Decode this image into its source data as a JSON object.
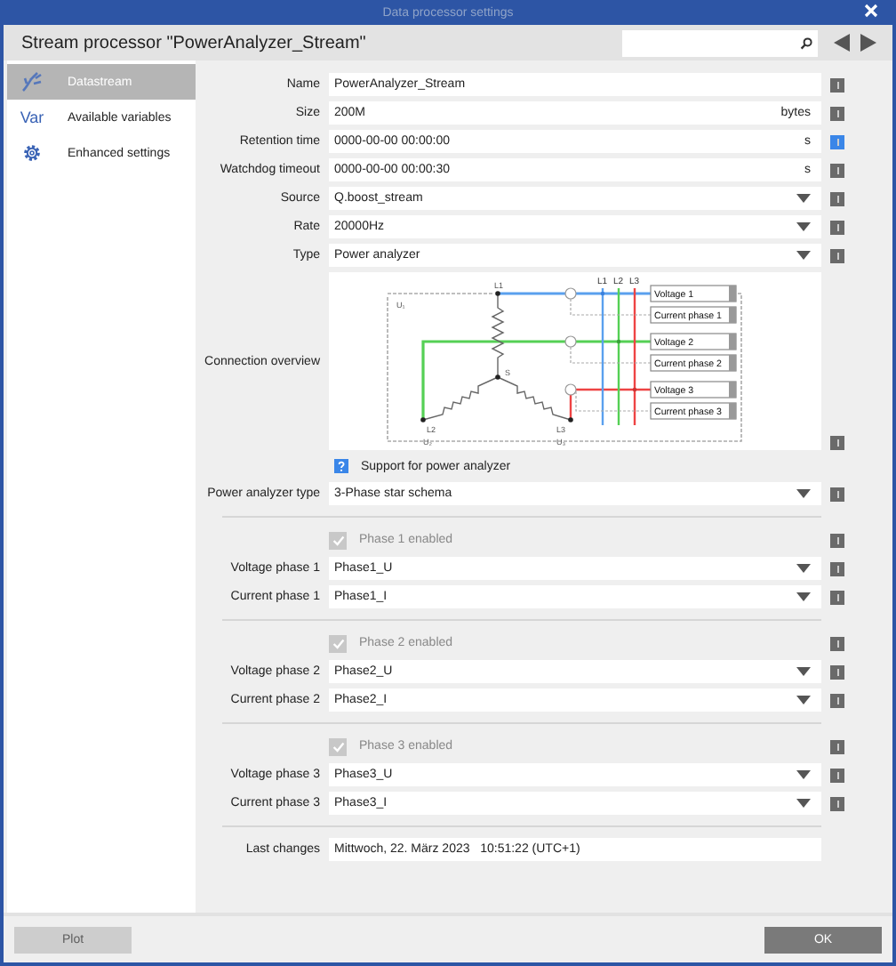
{
  "window": {
    "title": "Data processor settings"
  },
  "header": {
    "title": "Stream processor \"PowerAnalyzer_Stream\""
  },
  "sidebar": {
    "items": [
      {
        "kind": "wave",
        "label": "Datastream",
        "selected": true
      },
      {
        "kind": "var",
        "icon_text": "Var",
        "label": "Available variables",
        "selected": false
      },
      {
        "kind": "gear",
        "label": "Enhanced settings",
        "selected": false
      }
    ]
  },
  "form": {
    "rows": [
      {
        "kind": "text",
        "label": "Name",
        "value": "PowerAnalyzer_Stream",
        "info_active": false
      },
      {
        "kind": "text",
        "label": "Size",
        "value": "200M",
        "unit": "bytes",
        "info_active": false
      },
      {
        "kind": "text",
        "label": "Retention time",
        "value": "0000-00-00 00:00:00",
        "unit": "s",
        "info_active": true
      },
      {
        "kind": "text",
        "label": "Watchdog timeout",
        "value": "0000-00-00 00:00:30",
        "unit": "s",
        "info_active": false
      },
      {
        "kind": "select",
        "label": "Source",
        "value": "Q.boost_stream",
        "info_active": false
      },
      {
        "kind": "select",
        "label": "Rate",
        "value": "20000Hz",
        "info_active": false
      },
      {
        "kind": "select",
        "label": "Type",
        "value": "Power analyzer",
        "info_active": false
      },
      {
        "kind": "diagram",
        "label": "Connection overview",
        "info_active": false,
        "line_labels": [
          "L1",
          "L2",
          "L3"
        ],
        "node_labels": [
          "L1",
          "U₁",
          "S",
          "L2",
          "U₂",
          "L3",
          "U₃"
        ],
        "terminals": [
          "Voltage 1",
          "Current phase 1",
          "Voltage 2",
          "Current phase 2",
          "Voltage 3",
          "Current phase 3"
        ]
      },
      {
        "kind": "help",
        "text": "Support for power analyzer"
      },
      {
        "kind": "select",
        "label": "Power analyzer type",
        "value": "3-Phase star schema",
        "info_active": false
      },
      {
        "kind": "divider"
      },
      {
        "kind": "check",
        "label": "Phase 1 enabled",
        "checked": true,
        "disabled": true,
        "info_active": false
      },
      {
        "kind": "select",
        "label": "Voltage phase 1",
        "value": "Phase1_U",
        "info_active": false
      },
      {
        "kind": "select",
        "label": "Current phase 1",
        "value": "Phase1_I",
        "info_active": false
      },
      {
        "kind": "divider"
      },
      {
        "kind": "check",
        "label": "Phase 2 enabled",
        "checked": true,
        "disabled": true,
        "info_active": false
      },
      {
        "kind": "select",
        "label": "Voltage phase 2",
        "value": "Phase2_U",
        "info_active": false
      },
      {
        "kind": "select",
        "label": "Current phase 2",
        "value": "Phase2_I",
        "info_active": false
      },
      {
        "kind": "divider"
      },
      {
        "kind": "check",
        "label": "Phase 3 enabled",
        "checked": true,
        "disabled": true,
        "info_active": false
      },
      {
        "kind": "select",
        "label": "Voltage phase 3",
        "value": "Phase3_U",
        "info_active": false
      },
      {
        "kind": "select",
        "label": "Current phase 3",
        "value": "Phase3_I",
        "info_active": false
      },
      {
        "kind": "divider"
      },
      {
        "kind": "plain",
        "label": "Last changes",
        "value": "Mittwoch, 22. März 2023   10:51:22 (UTC+1)"
      }
    ]
  },
  "footer": {
    "buttons": [
      {
        "label": "Plot",
        "disabled": true
      },
      {
        "label": "OK",
        "disabled": false
      }
    ]
  }
}
